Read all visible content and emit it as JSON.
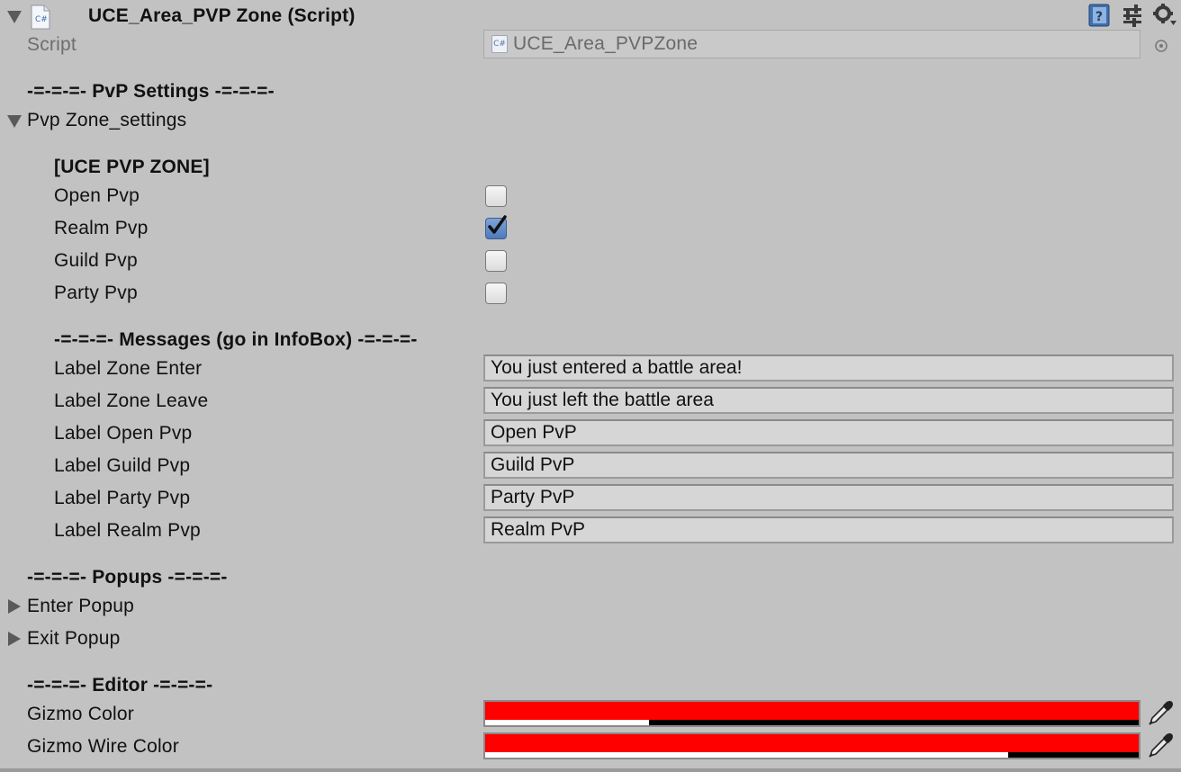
{
  "header": {
    "title": "UCE_Area_PVP Zone (Script)",
    "script_icon": "C#"
  },
  "script_row": {
    "label": "Script",
    "value": "UCE_Area_PVPZone",
    "icon": "C#"
  },
  "pvp_settings": {
    "section_title": "-=-=-=- PvP Settings -=-=-=-",
    "foldout_label": "Pvp Zone_settings",
    "header_label": "[UCE PVP ZONE]",
    "toggles": [
      {
        "label": "Open Pvp",
        "checked": false
      },
      {
        "label": "Realm Pvp",
        "checked": true
      },
      {
        "label": "Guild Pvp",
        "checked": false
      },
      {
        "label": "Party Pvp",
        "checked": false
      }
    ]
  },
  "messages": {
    "section_title": "-=-=-=- Messages (go in InfoBox) -=-=-=-",
    "fields": [
      {
        "label": "Label Zone Enter",
        "value": "You just entered a battle area!"
      },
      {
        "label": "Label Zone Leave",
        "value": "You just left the battle area"
      },
      {
        "label": "Label Open Pvp",
        "value": "Open PvP"
      },
      {
        "label": "Label Guild Pvp",
        "value": "Guild PvP"
      },
      {
        "label": "Label Party Pvp",
        "value": "Party PvP"
      },
      {
        "label": "Label Realm Pvp",
        "value": "Realm PvP"
      }
    ]
  },
  "popups": {
    "section_title": "-=-=-=- Popups -=-=-=-",
    "items": [
      {
        "label": "Enter Popup"
      },
      {
        "label": "Exit Popup"
      }
    ]
  },
  "editor": {
    "section_title": "-=-=-=- Editor -=-=-=-",
    "colors": [
      {
        "label": "Gizmo Color",
        "color": "#ff0000",
        "alpha": 0.25
      },
      {
        "label": "Gizmo Wire Color",
        "color": "#ff0000",
        "alpha": 0.8
      }
    ]
  },
  "icons": {
    "help": "help-book-icon",
    "presets": "presets-sliders-icon",
    "settings": "gear-icon",
    "picker": "pipette-icon",
    "object_picker": "object-picker-icon"
  }
}
